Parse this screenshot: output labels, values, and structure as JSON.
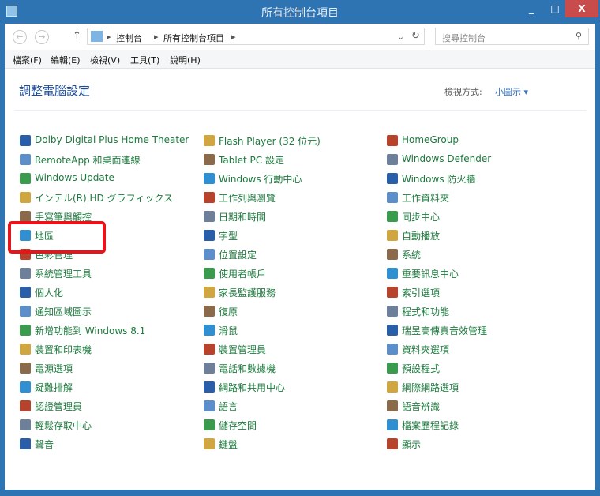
{
  "window": {
    "title": "所有控制台項目",
    "minimize": "_",
    "maximize": "□",
    "close": "X"
  },
  "nav": {
    "back": "←",
    "forward": "→",
    "up": "↑",
    "breadcrumbs": [
      "控制台",
      "所有控制台項目"
    ],
    "search_placeholder": "搜尋控制台"
  },
  "menu": [
    "檔案(F)",
    "編輯(E)",
    "檢視(V)",
    "工具(T)",
    "說明(H)"
  ],
  "heading": "調整電腦設定",
  "view_by": {
    "label": "檢視方式:",
    "value": "小圖示 ▾"
  },
  "highlight": "地區",
  "columns": [
    [
      "Dolby Digital Plus Home Theater",
      "RemoteApp 和桌面連線",
      "Windows Update",
      "インテル(R) HD グラフィックス",
      "手寫筆與觸控",
      "地區",
      "色彩管理",
      "系統管理工具",
      "個人化",
      "通知區域圖示",
      "新增功能到 Windows 8.1",
      "裝置和印表機",
      "電源選項",
      "疑難排解",
      "認證管理員",
      "輕鬆存取中心",
      "聲音"
    ],
    [
      "Flash Player (32 位元)",
      "Tablet PC 設定",
      "Windows 行動中心",
      "工作列與瀏覽",
      "日期和時間",
      "字型",
      "位置設定",
      "使用者帳戶",
      "家長監護服務",
      "復原",
      "滑鼠",
      "裝置管理員",
      "電話和數據機",
      "網路和共用中心",
      "語言",
      "儲存空間",
      "鍵盤"
    ],
    [
      "HomeGroup",
      "Windows Defender",
      "Windows 防火牆",
      "工作資料夾",
      "同步中心",
      "自動播放",
      "系統",
      "重要訊息中心",
      "索引選項",
      "程式和功能",
      "瑞昱高傳真音效管理",
      "資料夾選項",
      "預設程式",
      "網際網路選項",
      "語音辨識",
      "檔案歷程記錄",
      "顯示"
    ]
  ],
  "colors": {
    "frame": "#2e74b3",
    "link": "#1d7a3e",
    "heading": "#1e4e9b",
    "highlight": "#e8141b"
  }
}
